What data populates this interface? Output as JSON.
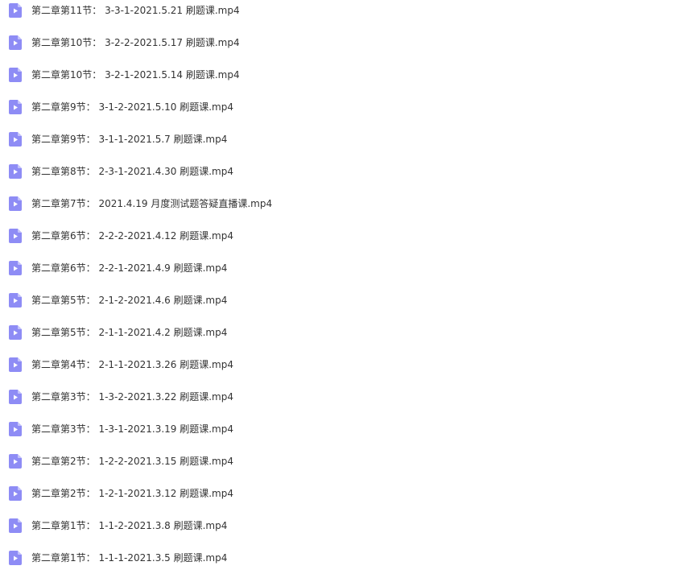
{
  "colors": {
    "icon_fill": "#8e8cf5",
    "icon_fold": "#c3c2fb",
    "icon_glyph": "#ffffff",
    "text": "#333333"
  },
  "files": [
    {
      "name": "第二章第11节： 3-3-1-2021.5.21 刷题课.mp4",
      "icon": "video-file-icon"
    },
    {
      "name": "第二章第10节： 3-2-2-2021.5.17 刷题课.mp4",
      "icon": "video-file-icon"
    },
    {
      "name": "第二章第10节： 3-2-1-2021.5.14 刷题课.mp4",
      "icon": "video-file-icon"
    },
    {
      "name": "第二章第9节： 3-1-2-2021.5.10 刷题课.mp4",
      "icon": "video-file-icon"
    },
    {
      "name": "第二章第9节： 3-1-1-2021.5.7 刷题课.mp4",
      "icon": "video-file-icon"
    },
    {
      "name": "第二章第8节： 2-3-1-2021.4.30 刷题课.mp4",
      "icon": "video-file-icon"
    },
    {
      "name": "第二章第7节： 2021.4.19 月度测试题答疑直播课.mp4",
      "icon": "video-file-icon"
    },
    {
      "name": "第二章第6节： 2-2-2-2021.4.12 刷题课.mp4",
      "icon": "video-file-icon"
    },
    {
      "name": "第二章第6节： 2-2-1-2021.4.9 刷题课.mp4",
      "icon": "video-file-icon"
    },
    {
      "name": "第二章第5节： 2-1-2-2021.4.6 刷题课.mp4",
      "icon": "video-file-icon"
    },
    {
      "name": "第二章第5节： 2-1-1-2021.4.2 刷题课.mp4",
      "icon": "video-file-icon"
    },
    {
      "name": "第二章第4节： 2-1-1-2021.3.26 刷题课.mp4",
      "icon": "video-file-icon"
    },
    {
      "name": "第二章第3节： 1-3-2-2021.3.22 刷题课.mp4",
      "icon": "video-file-icon"
    },
    {
      "name": "第二章第3节： 1-3-1-2021.3.19 刷题课.mp4",
      "icon": "video-file-icon"
    },
    {
      "name": "第二章第2节： 1-2-2-2021.3.15 刷题课.mp4",
      "icon": "video-file-icon"
    },
    {
      "name": "第二章第2节： 1-2-1-2021.3.12 刷题课.mp4",
      "icon": "video-file-icon"
    },
    {
      "name": "第二章第1节： 1-1-2-2021.3.8 刷题课.mp4",
      "icon": "video-file-icon"
    },
    {
      "name": "第二章第1节： 1-1-1-2021.3.5 刷题课.mp4",
      "icon": "video-file-icon"
    }
  ]
}
